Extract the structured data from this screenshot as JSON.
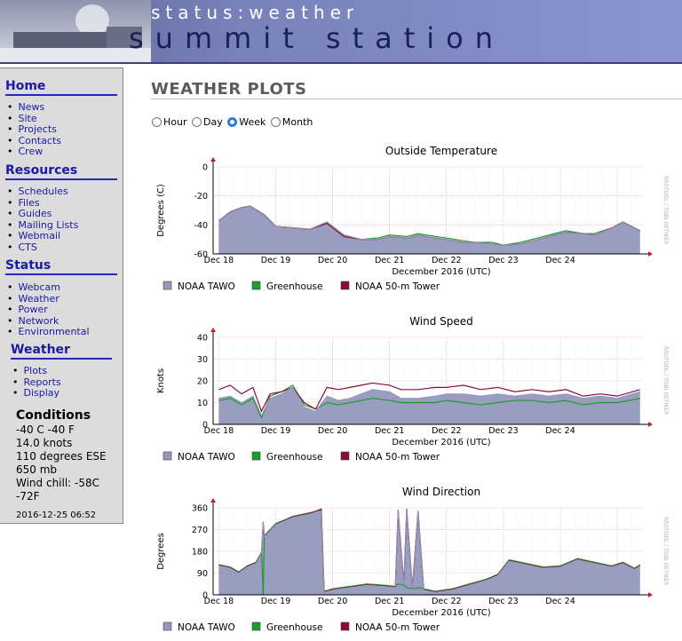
{
  "header": {
    "subtitle": "status:weather",
    "title": "summit station"
  },
  "sidebar": {
    "home": {
      "heading": "Home",
      "items": [
        "News",
        "Site",
        "Projects",
        "Contacts",
        "Crew"
      ]
    },
    "resources": {
      "heading": "Resources",
      "items": [
        "Schedules",
        "Files",
        "Guides",
        "Mailing Lists",
        "Webmail",
        "CTS"
      ]
    },
    "status": {
      "heading": "Status",
      "items": [
        "Webcam",
        "Weather",
        "Power",
        "Network",
        "Environmental"
      ]
    },
    "weather": {
      "heading": "Weather",
      "items": [
        "Plots",
        "Reports",
        "Display"
      ]
    },
    "conditions": {
      "heading": "Conditions",
      "lines": [
        "-40 C -40 F",
        "14.0 knots",
        "110 degrees ESE",
        "650 mb",
        "Wind chill: -58C",
        "-72F"
      ],
      "timestamp": "2016-12-25 06:52"
    }
  },
  "main": {
    "title": "WEATHER PLOTS",
    "range_options": [
      "Hour",
      "Day",
      "Week",
      "Month"
    ],
    "range_selected": "Week"
  },
  "colors": {
    "tawo": "#9498bd",
    "greenhouse": "#1c9c2c",
    "tower": "#8c0c38"
  },
  "chart_data": [
    {
      "type": "area",
      "title": "Outside Temperature",
      "ylabel": "Degrees (C)",
      "xlabel": "December 2016 (UTC)",
      "ylim": [
        -60,
        0
      ],
      "yticks": [
        "0",
        "-20",
        "-40",
        "-60"
      ],
      "xticks": [
        "Dec 18",
        "Dec 19",
        "Dec 20",
        "Dec 21",
        "Dec 22",
        "Dec 23",
        "Dec 24"
      ],
      "x_days": [
        18,
        18.2,
        18.4,
        18.55,
        18.8,
        19.0,
        19.3,
        19.6,
        19.9,
        20.2,
        20.5,
        20.8,
        21.0,
        21.3,
        21.5,
        21.8,
        22.0,
        22.3,
        22.5,
        22.8,
        23.0,
        23.3,
        23.6,
        23.9,
        24.1,
        24.4,
        24.6,
        24.9,
        25.1,
        25.4
      ],
      "series": [
        {
          "name": "NOAA TAWO",
          "values": [
            -37,
            -31,
            -28,
            -27,
            -33,
            -41,
            -42,
            -43,
            -38,
            -47,
            -50,
            -50,
            -48,
            -49,
            -47,
            -49,
            -50,
            -52,
            -52,
            -53,
            -54,
            -53,
            -50,
            -47,
            -45,
            -46,
            -47,
            -42,
            -38,
            -44
          ]
        },
        {
          "name": "Greenhouse",
          "values": [
            -37,
            -31,
            -28,
            -27,
            -33,
            -41,
            -42,
            -43,
            -38,
            -47,
            -50,
            -49,
            -47,
            -48,
            -46,
            -48,
            -49,
            -51,
            -52,
            -52,
            -54,
            -52,
            -49,
            -46,
            -44,
            -46,
            -46,
            -42,
            -38,
            -44
          ]
        },
        {
          "name": "NOAA 50-m Tower",
          "values": [
            -37,
            -31,
            -28,
            -27,
            -33,
            -41,
            -42,
            -43,
            -39,
            -48,
            -50,
            -50,
            -48,
            -49,
            -47,
            -49,
            -50,
            -52,
            -52,
            -53,
            -54,
            -53,
            -50,
            -47,
            -45,
            -46,
            -47,
            -42,
            -38,
            -44
          ]
        }
      ],
      "legend": [
        "NOAA TAWO",
        "Greenhouse",
        "NOAA 50-m Tower"
      ]
    },
    {
      "type": "area",
      "title": "Wind Speed",
      "ylabel": "Knots",
      "xlabel": "December 2016 (UTC)",
      "ylim": [
        0,
        40
      ],
      "yticks": [
        "40",
        "30",
        "20",
        "10",
        "0"
      ],
      "xticks": [
        "Dec 18",
        "Dec 19",
        "Dec 20",
        "Dec 21",
        "Dec 22",
        "Dec 23",
        "Dec 24"
      ],
      "x_days": [
        18,
        18.2,
        18.4,
        18.6,
        18.75,
        18.9,
        19.1,
        19.3,
        19.5,
        19.7,
        19.9,
        20.1,
        20.3,
        20.5,
        20.7,
        21.0,
        21.2,
        21.5,
        21.8,
        22.0,
        22.3,
        22.6,
        22.9,
        23.2,
        23.5,
        23.8,
        24.1,
        24.4,
        24.7,
        25.0,
        25.4
      ],
      "series": [
        {
          "name": "NOAA TAWO",
          "values": [
            12,
            13,
            10,
            13,
            4,
            12,
            14,
            17,
            8,
            6,
            13,
            11,
            12,
            14,
            16,
            15,
            12,
            12,
            13,
            14,
            14,
            13,
            14,
            13,
            14,
            13,
            14,
            12,
            13,
            12,
            15
          ]
        },
        {
          "name": "Greenhouse",
          "values": [
            11,
            12,
            9,
            12,
            3,
            13,
            15,
            18,
            9,
            7,
            10,
            9,
            10,
            11,
            12,
            11,
            10,
            10,
            10,
            11,
            10,
            9,
            10,
            11,
            11,
            10,
            11,
            9,
            10,
            10,
            12
          ]
        },
        {
          "name": "NOAA 50-m Tower",
          "values": [
            16,
            18,
            14,
            17,
            6,
            14,
            15,
            17,
            10,
            7,
            17,
            16,
            17,
            18,
            19,
            18,
            16,
            16,
            17,
            17,
            18,
            16,
            17,
            15,
            16,
            15,
            16,
            13,
            14,
            13,
            16
          ]
        }
      ],
      "legend": [
        "NOAA TAWO",
        "Greenhouse",
        "NOAA 50-m Tower"
      ]
    },
    {
      "type": "area",
      "title": "Wind Direction",
      "ylabel": "Degrees",
      "xlabel": "December 2016 (UTC)",
      "ylim": [
        0,
        360
      ],
      "yticks": [
        "360",
        "270",
        "180",
        "90",
        "0"
      ],
      "xticks": [
        "Dec 18",
        "Dec 19",
        "Dec 20",
        "Dec 21",
        "Dec 22",
        "Dec 23",
        "Dec 24"
      ],
      "x_days": [
        18,
        18.2,
        18.35,
        18.5,
        18.65,
        18.75,
        18.78,
        18.8,
        19.0,
        19.3,
        19.6,
        19.8,
        19.85,
        20.0,
        20.3,
        20.6,
        20.9,
        21.1,
        21.15,
        21.25,
        21.3,
        21.4,
        21.5,
        21.6,
        21.8,
        22.1,
        22.4,
        22.7,
        22.9,
        23.1,
        23.4,
        23.7,
        24.0,
        24.3,
        24.6,
        24.9,
        25.1,
        25.3,
        25.4
      ],
      "series": [
        {
          "name": "NOAA TAWO",
          "values": [
            120,
            110,
            90,
            115,
            130,
            170,
            300,
            240,
            290,
            320,
            335,
            345,
            10,
            20,
            30,
            40,
            35,
            30,
            350,
            40,
            355,
            25,
            345,
            20,
            10,
            20,
            40,
            60,
            80,
            140,
            125,
            110,
            115,
            145,
            130,
            115,
            130,
            105,
            120
          ]
        },
        {
          "name": "Greenhouse",
          "values": [
            125,
            115,
            95,
            120,
            135,
            175,
            0,
            245,
            295,
            325,
            340,
            350,
            15,
            25,
            35,
            45,
            40,
            35,
            45,
            40,
            30,
            25,
            30,
            25,
            15,
            25,
            45,
            65,
            85,
            145,
            130,
            115,
            120,
            150,
            135,
            120,
            135,
            110,
            125
          ]
        },
        {
          "name": "NOAA 50-m Tower",
          "values": [
            122,
            112,
            92,
            117,
            132,
            172,
            302,
            242,
            292,
            322,
            337,
            355,
            12,
            22,
            32,
            42,
            37,
            32,
            352,
            42,
            357,
            27,
            347,
            22,
            12,
            22,
            42,
            62,
            82,
            142,
            127,
            112,
            117,
            147,
            132,
            117,
            132,
            107,
            122
          ]
        }
      ],
      "legend": [
        "NOAA TAWO",
        "Greenhouse",
        "NOAA 50-m Tower"
      ]
    }
  ],
  "watermark": "RRDTOOL / TOBI OETIKER"
}
